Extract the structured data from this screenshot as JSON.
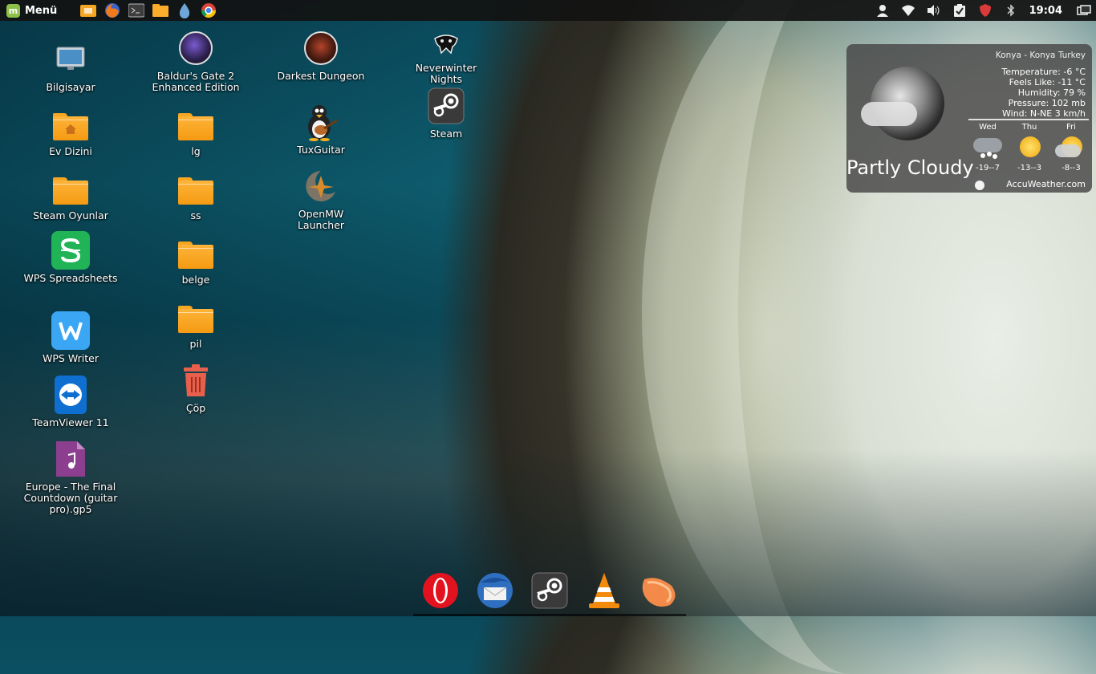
{
  "panel": {
    "menu_label": "Menü",
    "clock": "19:04",
    "launchers": [
      "files-app-icon",
      "firefox-icon",
      "terminal-icon",
      "folder-icon",
      "water-icon",
      "chrome-icon"
    ],
    "tray": [
      "user-icon",
      "wifi-icon",
      "volume-icon",
      "clipboard-icon",
      "shield-icon",
      "bluetooth-icon"
    ]
  },
  "desktop": {
    "icons": [
      {
        "label": "Bilgisayar"
      },
      {
        "label": "Ev Dizini"
      },
      {
        "label": "Steam Oyunlar"
      },
      {
        "label": "WPS Spreadsheets"
      },
      {
        "label": "WPS Writer"
      },
      {
        "label": "TeamViewer 11"
      },
      {
        "label": "Europe - The Final Countdown (guitar pro).gp5"
      },
      {
        "label": "Baldur's Gate 2 Enhanced Edition"
      },
      {
        "label": "lg"
      },
      {
        "label": "ss"
      },
      {
        "label": "belge"
      },
      {
        "label": "pil"
      },
      {
        "label": "Çöp"
      },
      {
        "label": "Darkest Dungeon"
      },
      {
        "label": "TuxGuitar"
      },
      {
        "label": "OpenMW Launcher"
      },
      {
        "label": "Neverwinter Nights"
      },
      {
        "label": "Steam"
      }
    ]
  },
  "weather": {
    "location": "Konya - Konya Turkey",
    "temperature": "Temperature: -6 °C",
    "feels_like": "Feels Like: -11 °C",
    "humidity": "Humidity: 79 %",
    "pressure": "Pressure: 102 mb",
    "wind": "Wind: N-NE 3 km/h",
    "condition": "Partly Cloudy",
    "days": [
      {
        "name": "Wed",
        "range": "-19--7"
      },
      {
        "name": "Thu",
        "range": "-13--3"
      },
      {
        "name": "Fri",
        "range": "-8--3"
      }
    ],
    "source": "AccuWeather.com"
  },
  "dock": [
    "opera-icon",
    "thunderbird-icon",
    "steam-icon",
    "vlc-icon",
    "clementine-icon"
  ],
  "colors": {
    "folder": "#f5a623",
    "wps_green": "#20b457",
    "wps_blue": "#3aa6f4",
    "mint": "#8dc149"
  }
}
